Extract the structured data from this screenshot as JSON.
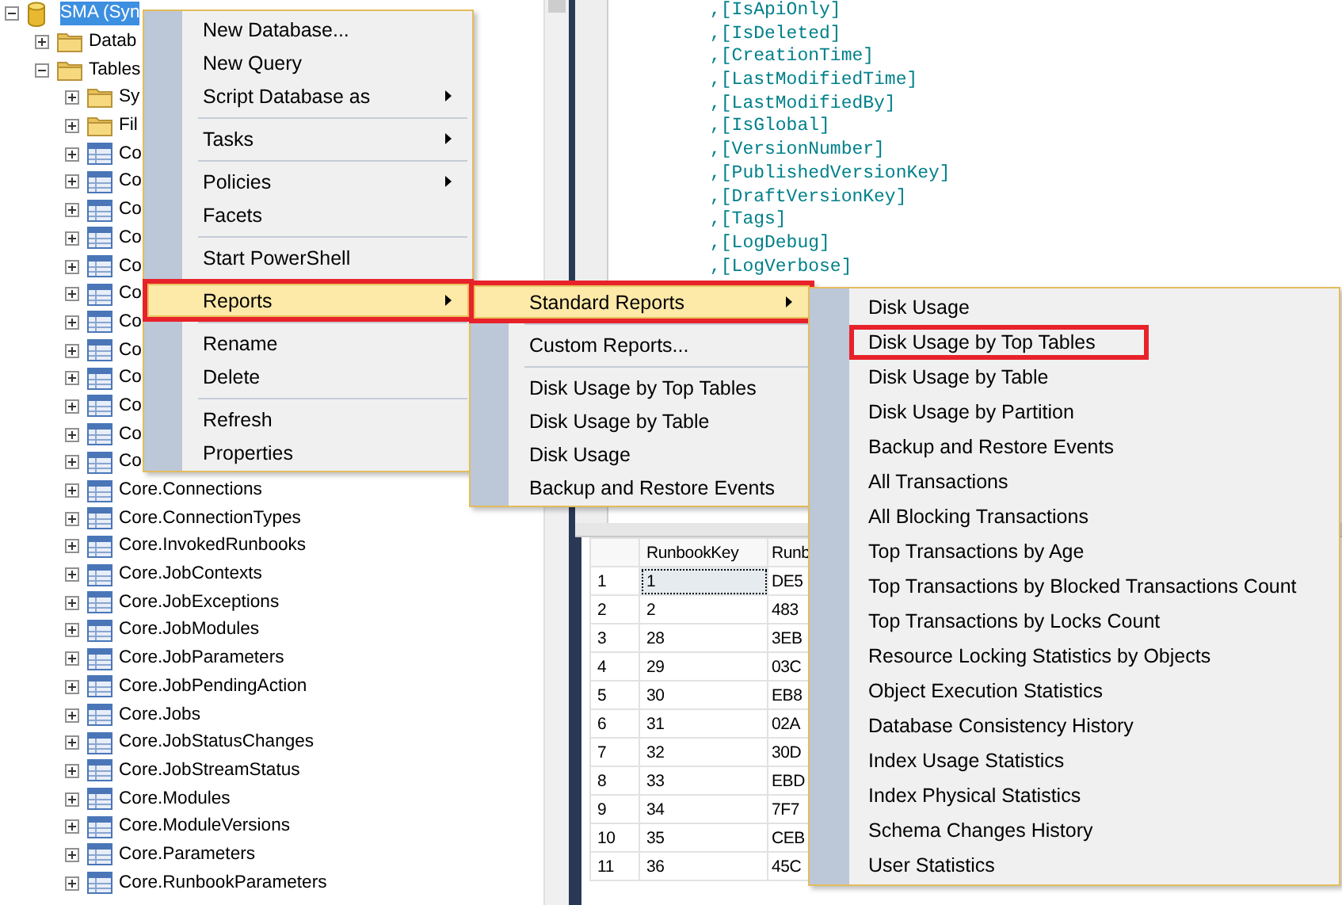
{
  "object_explorer": {
    "tree": [
      {
        "label": "SMA (Syn",
        "kind": "database",
        "selected": true,
        "expanded": true,
        "children": [
          {
            "label": "Datab",
            "kind": "folder",
            "selected": false,
            "expanded": false
          },
          {
            "label": "Tables",
            "kind": "folder",
            "selected": false,
            "expanded": true,
            "children": [
              {
                "label": "Sy",
                "kind": "folder",
                "selected": false,
                "expanded": false
              },
              {
                "label": "Fil",
                "kind": "folder",
                "selected": false,
                "expanded": false
              },
              {
                "label": "Co",
                "kind": "table",
                "selected": false,
                "expanded": false
              },
              {
                "label": "Co",
                "kind": "table",
                "selected": false,
                "expanded": false
              },
              {
                "label": "Co",
                "kind": "table",
                "selected": false,
                "expanded": false
              },
              {
                "label": "Co",
                "kind": "table",
                "selected": false,
                "expanded": false
              },
              {
                "label": "Co",
                "kind": "table",
                "selected": false,
                "expanded": false
              },
              {
                "label": "Co",
                "kind": "table",
                "selected": false,
                "expanded": false
              },
              {
                "label": "Co",
                "kind": "table",
                "selected": false,
                "expanded": false
              },
              {
                "label": "Co",
                "kind": "table",
                "selected": false,
                "expanded": false
              },
              {
                "label": "Co",
                "kind": "table",
                "selected": false,
                "expanded": false
              },
              {
                "label": "Co",
                "kind": "table",
                "selected": false,
                "expanded": false
              },
              {
                "label": "Co",
                "kind": "table",
                "selected": false,
                "expanded": false
              },
              {
                "label": "Co",
                "kind": "table",
                "selected": false,
                "expanded": false
              },
              {
                "label": "Core.Connections",
                "kind": "table",
                "selected": false,
                "expanded": false
              },
              {
                "label": "Core.ConnectionTypes",
                "kind": "table",
                "selected": false,
                "expanded": false
              },
              {
                "label": "Core.InvokedRunbooks",
                "kind": "table",
                "selected": false,
                "expanded": false
              },
              {
                "label": "Core.JobContexts",
                "kind": "table",
                "selected": false,
                "expanded": false
              },
              {
                "label": "Core.JobExceptions",
                "kind": "table",
                "selected": false,
                "expanded": false
              },
              {
                "label": "Core.JobModules",
                "kind": "table",
                "selected": false,
                "expanded": false
              },
              {
                "label": "Core.JobParameters",
                "kind": "table",
                "selected": false,
                "expanded": false
              },
              {
                "label": "Core.JobPendingAction",
                "kind": "table",
                "selected": false,
                "expanded": false
              },
              {
                "label": "Core.Jobs",
                "kind": "table",
                "selected": false,
                "expanded": false
              },
              {
                "label": "Core.JobStatusChanges",
                "kind": "table",
                "selected": false,
                "expanded": false
              },
              {
                "label": "Core.JobStreamStatus",
                "kind": "table",
                "selected": false,
                "expanded": false
              },
              {
                "label": "Core.Modules",
                "kind": "table",
                "selected": false,
                "expanded": false
              },
              {
                "label": "Core.ModuleVersions",
                "kind": "table",
                "selected": false,
                "expanded": false
              },
              {
                "label": "Core.Parameters",
                "kind": "table",
                "selected": false,
                "expanded": false
              },
              {
                "label": "Core.RunbookParameters",
                "kind": "table",
                "selected": false,
                "expanded": false
              }
            ]
          }
        ]
      }
    ]
  },
  "query_editor": {
    "lines": [
      ",[IsApiOnly]",
      ",[IsDeleted]",
      ",[CreationTime]",
      ",[LastModifiedTime]",
      ",[LastModifiedBy]",
      ",[IsGlobal]",
      ",[VersionNumber]",
      ",[PublishedVersionKey]",
      ",[DraftVersionKey]",
      ",[Tags]",
      ",[LogDebug]",
      ",[LogVerbose]"
    ]
  },
  "results_grid": {
    "columns": [
      "RunbookKey",
      "Runb"
    ],
    "rows": [
      {
        "number": "1",
        "cells": [
          "1",
          "DE5"
        ],
        "selected": true
      },
      {
        "number": "2",
        "cells": [
          "2",
          "483"
        ],
        "selected": false
      },
      {
        "number": "3",
        "cells": [
          "28",
          "3EB"
        ],
        "selected": false
      },
      {
        "number": "4",
        "cells": [
          "29",
          "03C"
        ],
        "selected": false
      },
      {
        "number": "5",
        "cells": [
          "30",
          "EB8"
        ],
        "selected": false
      },
      {
        "number": "6",
        "cells": [
          "31",
          "02A"
        ],
        "selected": false
      },
      {
        "number": "7",
        "cells": [
          "32",
          "30D"
        ],
        "selected": false
      },
      {
        "number": "8",
        "cells": [
          "33",
          "EBD"
        ],
        "selected": false
      },
      {
        "number": "9",
        "cells": [
          "34",
          "7F7"
        ],
        "selected": false
      },
      {
        "number": "10",
        "cells": [
          "35",
          "CEB"
        ],
        "selected": false
      },
      {
        "number": "11",
        "cells": [
          "36",
          "45C"
        ],
        "selected": false
      }
    ]
  },
  "context_menu": {
    "items": [
      {
        "kind": "item",
        "label": "New Database...",
        "submenu": false,
        "selected": false,
        "marked": false
      },
      {
        "kind": "item",
        "label": "New Query",
        "submenu": false,
        "selected": false,
        "marked": false
      },
      {
        "kind": "item",
        "label": "Script Database as",
        "submenu": true,
        "selected": false,
        "marked": false
      },
      {
        "kind": "separator"
      },
      {
        "kind": "item",
        "label": "Tasks",
        "submenu": true,
        "selected": false,
        "marked": false
      },
      {
        "kind": "separator"
      },
      {
        "kind": "item",
        "label": "Policies",
        "submenu": true,
        "selected": false,
        "marked": false
      },
      {
        "kind": "item",
        "label": "Facets",
        "submenu": false,
        "selected": false,
        "marked": false
      },
      {
        "kind": "separator"
      },
      {
        "kind": "item",
        "label": "Start PowerShell",
        "submenu": false,
        "selected": false,
        "marked": false
      },
      {
        "kind": "separator"
      },
      {
        "kind": "item",
        "label": "Reports",
        "submenu": true,
        "selected": true,
        "marked": true
      },
      {
        "kind": "separator"
      },
      {
        "kind": "item",
        "label": "Rename",
        "submenu": false,
        "selected": false,
        "marked": false
      },
      {
        "kind": "item",
        "label": "Delete",
        "submenu": false,
        "selected": false,
        "marked": false
      },
      {
        "kind": "separator"
      },
      {
        "kind": "item",
        "label": "Refresh",
        "submenu": false,
        "selected": false,
        "marked": false
      },
      {
        "kind": "item",
        "label": "Properties",
        "submenu": false,
        "selected": false,
        "marked": false
      }
    ]
  },
  "reports_submenu": {
    "items": [
      {
        "kind": "item",
        "label": "Standard Reports",
        "submenu": true,
        "selected": true,
        "marked": true
      },
      {
        "kind": "separator"
      },
      {
        "kind": "item",
        "label": "Custom Reports...",
        "submenu": false,
        "selected": false,
        "marked": false
      },
      {
        "kind": "separator"
      },
      {
        "kind": "item",
        "label": "Disk Usage by Top Tables",
        "submenu": false,
        "selected": false,
        "marked": false
      },
      {
        "kind": "item",
        "label": "Disk Usage by Table",
        "submenu": false,
        "selected": false,
        "marked": false
      },
      {
        "kind": "item",
        "label": "Disk Usage",
        "submenu": false,
        "selected": false,
        "marked": false
      },
      {
        "kind": "item",
        "label": "Backup and Restore Events",
        "submenu": false,
        "selected": false,
        "marked": false
      }
    ]
  },
  "standard_reports_submenu": {
    "items": [
      {
        "kind": "item",
        "label": "Disk Usage",
        "submenu": false,
        "selected": false,
        "marked": false
      },
      {
        "kind": "item",
        "label": "Disk Usage by Top Tables",
        "submenu": false,
        "selected": false,
        "marked": true
      },
      {
        "kind": "item",
        "label": "Disk Usage by Table",
        "submenu": false,
        "selected": false,
        "marked": false
      },
      {
        "kind": "item",
        "label": "Disk Usage by Partition",
        "submenu": false,
        "selected": false,
        "marked": false
      },
      {
        "kind": "item",
        "label": "Backup and Restore Events",
        "submenu": false,
        "selected": false,
        "marked": false
      },
      {
        "kind": "item",
        "label": "All Transactions",
        "submenu": false,
        "selected": false,
        "marked": false
      },
      {
        "kind": "item",
        "label": "All Blocking Transactions",
        "submenu": false,
        "selected": false,
        "marked": false
      },
      {
        "kind": "item",
        "label": "Top Transactions by Age",
        "submenu": false,
        "selected": false,
        "marked": false
      },
      {
        "kind": "item",
        "label": "Top Transactions by Blocked Transactions Count",
        "submenu": false,
        "selected": false,
        "marked": false
      },
      {
        "kind": "item",
        "label": "Top Transactions by Locks Count",
        "submenu": false,
        "selected": false,
        "marked": false
      },
      {
        "kind": "item",
        "label": "Resource Locking Statistics by Objects",
        "submenu": false,
        "selected": false,
        "marked": false
      },
      {
        "kind": "item",
        "label": "Object Execution Statistics",
        "submenu": false,
        "selected": false,
        "marked": false
      },
      {
        "kind": "item",
        "label": "Database Consistency History",
        "submenu": false,
        "selected": false,
        "marked": false
      },
      {
        "kind": "item",
        "label": "Index Usage Statistics",
        "submenu": false,
        "selected": false,
        "marked": false
      },
      {
        "kind": "item",
        "label": "Index Physical Statistics",
        "submenu": false,
        "selected": false,
        "marked": false
      },
      {
        "kind": "item",
        "label": "Schema Changes History",
        "submenu": false,
        "selected": false,
        "marked": false
      },
      {
        "kind": "item",
        "label": "User Statistics",
        "submenu": false,
        "selected": false,
        "marked": false
      }
    ]
  }
}
